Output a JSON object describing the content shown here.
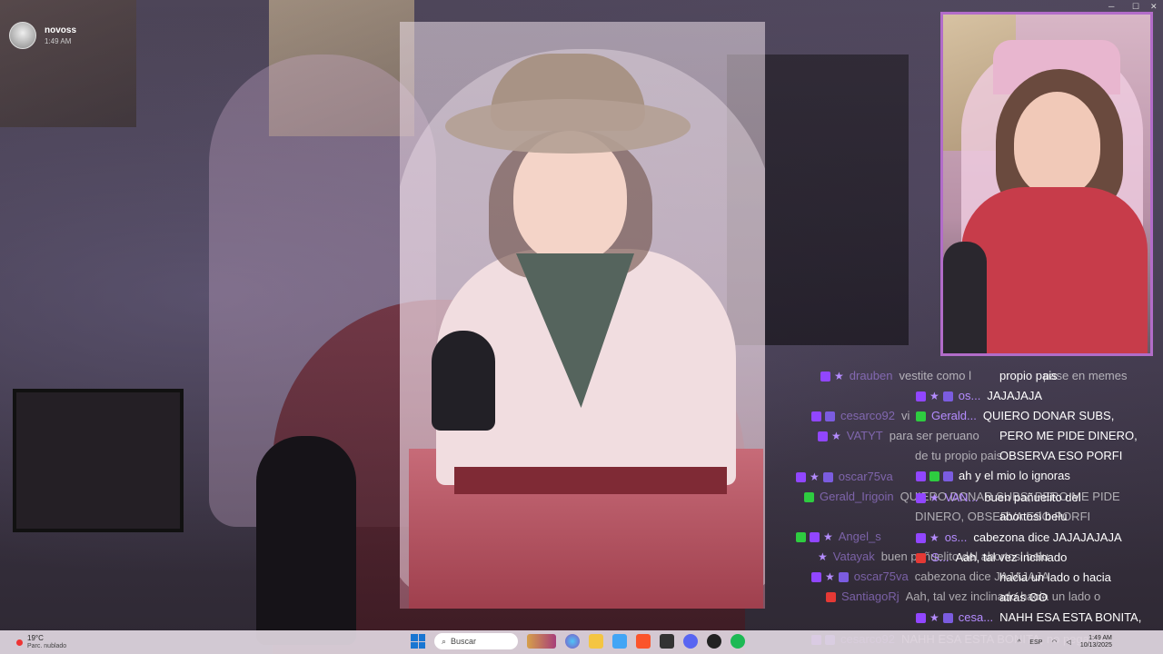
{
  "notification": {
    "user": "novoss",
    "time": "1:49 AM"
  },
  "chat_background": [
    {
      "user": "drauben",
      "message": "vestite como l",
      "badges": [
        "twitch-icon",
        "star-icon"
      ]
    },
    {
      "user": "cesarco92",
      "message": "vi",
      "badges": [
        "twitch-icon",
        "sub-badge"
      ]
    },
    {
      "user": "VATYT",
      "message": "para ser peruano",
      "badges": [
        "twitch-icon",
        "star-icon"
      ]
    },
    {
      "user": "",
      "message": "de tu propio pais",
      "badges": []
    },
    {
      "user": "oscar75va",
      "message": "",
      "badges": [
        "twitch-icon",
        "star-icon",
        "sub-badge"
      ]
    },
    {
      "user": "Gerald_Irigoin",
      "message": "QUIERO DONAR SUBS, PERO ME PIDE",
      "badges": [
        "green-badge"
      ]
    },
    {
      "user": "",
      "message": "DINERO, OBSERVA ESO PORFI",
      "badges": []
    },
    {
      "user": "Angel_s",
      "message": "",
      "badges": [
        "green-badge",
        "twitch-icon",
        "star-icon"
      ]
    },
    {
      "user": "Vatayak",
      "message": "buen pañuelito del abortosi belu",
      "badges": [
        "star-icon"
      ]
    },
    {
      "user": "oscar75va",
      "message": "cabezona dice JAJAJAJA",
      "badges": [
        "twitch-icon",
        "star-icon",
        "sub-badge"
      ]
    },
    {
      "user": "SantiagoRj",
      "message": "Aah, tal vez inclinado hacia un lado o",
      "badges": [
        "red-badge"
      ]
    },
    {
      "user": "cesarco92",
      "message": "NAHH ESA ESTA BONITA, no pega :V",
      "badges": [
        "twitch-icon",
        "sub-badge"
      ]
    }
  ],
  "chat_background_extra": "pase en memes",
  "chat_foreground": [
    {
      "user": "",
      "message": "propio pais",
      "badges": []
    },
    {
      "user": "os...",
      "message": "JAJAJAJA",
      "badges": [
        "twitch-icon",
        "star-icon",
        "sub-badge"
      ]
    },
    {
      "user": "Gerald...",
      "message": "QUIERO DONAR SUBS,",
      "badges": [
        "green-badge"
      ]
    },
    {
      "user": "",
      "message": "PERO ME PIDE DINERO,",
      "badges": []
    },
    {
      "user": "",
      "message": "OBSERVA ESO PORFI",
      "badges": []
    },
    {
      "user": "",
      "message": "ah y el mio lo ignoras",
      "badges": [
        "twitch-icon",
        "green-badge",
        "sub-badge"
      ]
    },
    {
      "user": "VAN...",
      "message": "buen pañuelito del",
      "badges": [
        "twitch-icon",
        "star-icon"
      ]
    },
    {
      "user": "",
      "message": "abortosi belu",
      "badges": []
    },
    {
      "user": "os...",
      "message": "cabezona dice JAJAJAJAJA",
      "badges": [
        "twitch-icon",
        "star-icon"
      ]
    },
    {
      "user": "S...",
      "message": "Aah, tal vez inclinado",
      "badges": [
        "red-badge"
      ]
    },
    {
      "user": "",
      "message": "hacia un lado o hacia",
      "badges": []
    },
    {
      "user": "",
      "message": "atrás ʘʘ",
      "badges": []
    },
    {
      "user": "cesa...",
      "message": "NAHH ESA ESTA BONITA,",
      "badges": [
        "twitch-icon",
        "star-icon",
        "sub-badge"
      ]
    }
  ],
  "taskbar": {
    "weather_temp": "19°C",
    "weather_desc": "Parc. nublado",
    "search_placeholder": "Buscar",
    "language": "ESP",
    "time": "1:49 AM",
    "date": "10/13/2025"
  },
  "colors": {
    "twitch": "#9146ff",
    "camera_border": "#b26cc9",
    "chat_user": "#b58cff"
  }
}
